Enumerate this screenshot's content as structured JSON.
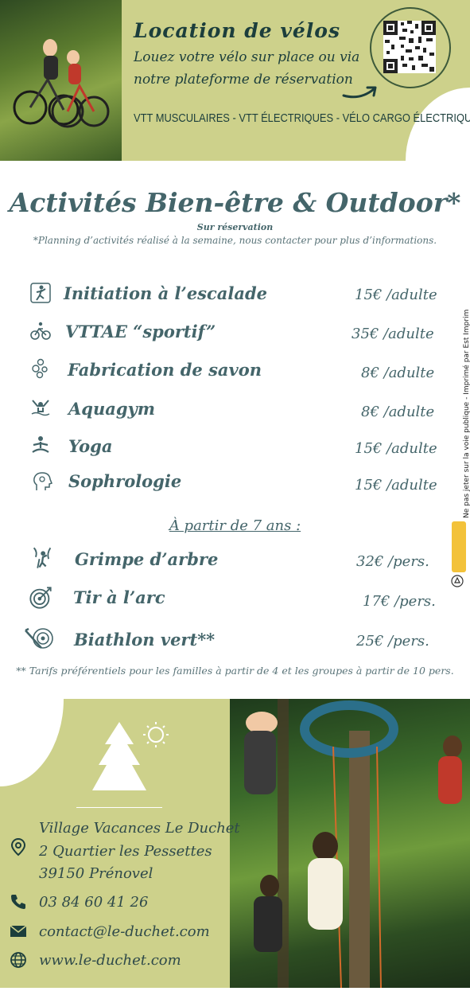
{
  "rental": {
    "title": "Location  de vélos",
    "line1": "Louez votre vélo sur place ou via",
    "line2": "notre plateforme de réservation",
    "types": "VTT MUSCULAIRES - VTT ÉLECTRIQUES - VÉLO CARGO ÉLECTRIQUE"
  },
  "activities": {
    "title": "Activités Bien-être & Outdoor*",
    "subtitle": "Sur réservation",
    "note": "*Planning d’activités réalisé à la semaine, nous contacter pour plus d’informations.",
    "items": [
      {
        "name": "Initiation à l’escalade",
        "price": "15€ /adulte",
        "icon": "climbing-icon"
      },
      {
        "name": "VTTAE “sportif”",
        "price": "35€ /adulte",
        "icon": "mountain-bike-icon"
      },
      {
        "name": "Fabrication de savon",
        "price": "8€ /adulte",
        "icon": "soap-bubbles-icon"
      },
      {
        "name": "Aquagym",
        "price": "8€ /adulte",
        "icon": "aquagym-icon"
      },
      {
        "name": "Yoga",
        "price": "15€ /adulte",
        "icon": "yoga-icon"
      },
      {
        "name": "Sophrologie",
        "price": "15€ /adulte",
        "icon": "sophrology-icon"
      }
    ],
    "age_note": "À partir de 7  ans :",
    "kids": [
      {
        "name": "Grimpe d’arbre",
        "price": "32€ /pers.",
        "icon": "tree-climbing-icon"
      },
      {
        "name": "Tir à l’arc",
        "price": "17€ /pers.",
        "icon": "target-icon"
      },
      {
        "name": "Biathlon vert**",
        "price": "25€ /pers.",
        "icon": "biathlon-icon"
      }
    ],
    "tarif_note": "** Tarifs préférentiels pour les familles à partir de 4 et les groupes à partir de 10 pers."
  },
  "side_text": "Ne pas jeter sur la voie publique - Imprimé par Est Imprim",
  "contact": {
    "name": "Village Vacances Le Duchet",
    "address1": "2 Quartier les Pessettes",
    "address2": "39150 Prénovel",
    "phone": "03 84 60 41 26",
    "email": "contact@le-duchet.com",
    "website": "www.le-duchet.com"
  },
  "colors": {
    "accent": "#cdd18b",
    "text": "#44656a",
    "dark": "#1c3e3c"
  }
}
